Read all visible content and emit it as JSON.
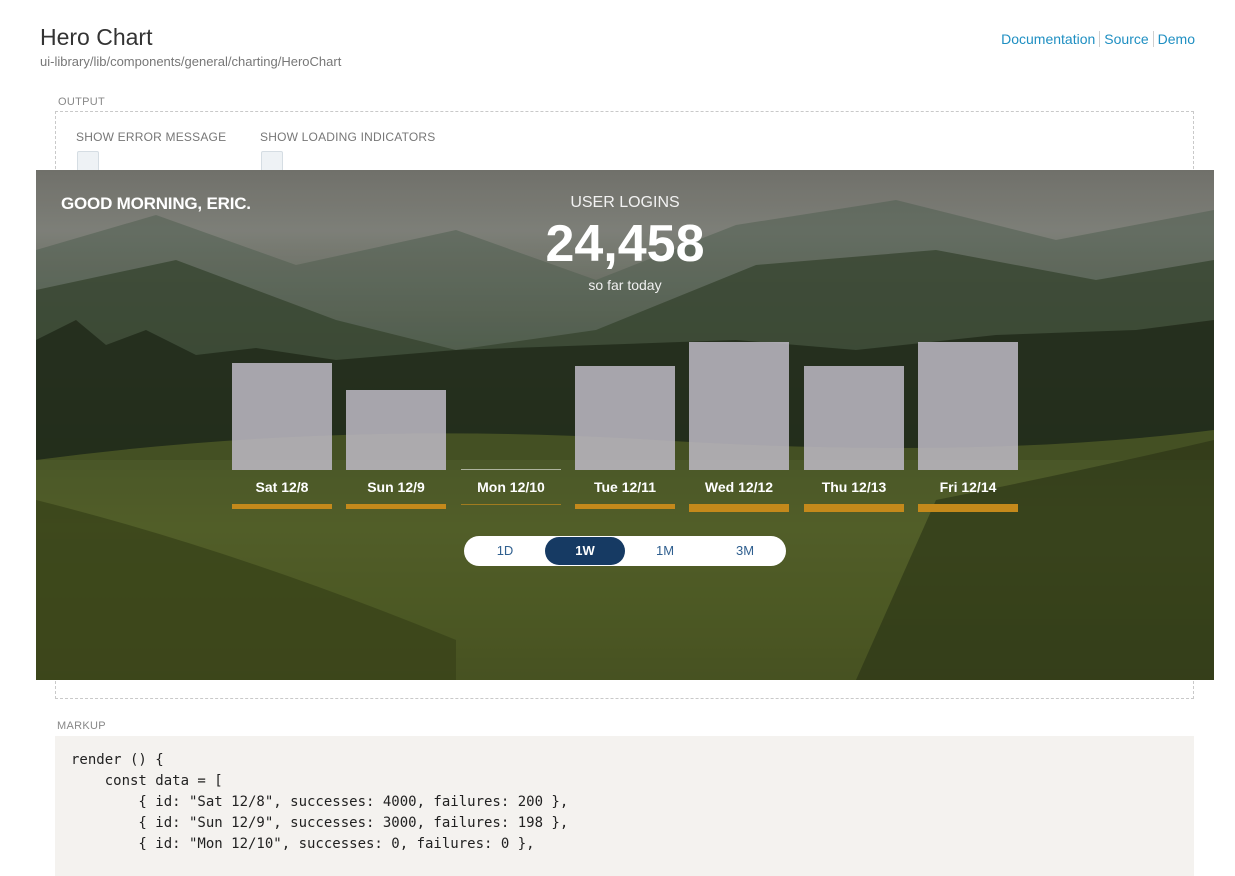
{
  "header": {
    "title": "Hero Chart",
    "path": "ui-library/lib/components/general/charting/HeroChart",
    "links": [
      "Documentation",
      "Source",
      "Demo"
    ]
  },
  "output": {
    "label": "OUTPUT",
    "options": [
      {
        "label": "SHOW ERROR MESSAGE",
        "checked": false
      },
      {
        "label": "SHOW LOADING INDICATORS",
        "checked": false
      }
    ]
  },
  "hero": {
    "greeting": "GOOD MORNING, ERIC.",
    "metric_label": "USER LOGINS",
    "value": "24,458",
    "subtitle": "so far today",
    "ranges": [
      "1D",
      "1W",
      "1M",
      "3M"
    ],
    "active_range": "1W"
  },
  "chart_data": {
    "type": "bar",
    "categories": [
      "Sat 12/8",
      "Sun 12/9",
      "Mon 12/10",
      "Tue 12/11",
      "Wed 12/12",
      "Thu 12/13",
      "Fri 12/14"
    ],
    "series": [
      {
        "values": [
          4000,
          3000,
          0,
          3900,
          4800,
          3900,
          4800
        ]
      },
      {
        "values": [
          200,
          198,
          0,
          200,
          300,
          300,
          300
        ]
      }
    ],
    "colors": {
      "successes": "#bebac6",
      "failures": "#c4891b"
    }
  },
  "markup": {
    "label": "MARKUP",
    "lines": [
      "render () {",
      "    const data = [",
      "        { id: \"Sat 12/8\", successes: 4000, failures: 200 },",
      "        { id: \"Sun 12/9\", successes: 3000, failures: 198 },",
      "        { id: \"Mon 12/10\", successes: 0, failures: 0 },"
    ]
  }
}
